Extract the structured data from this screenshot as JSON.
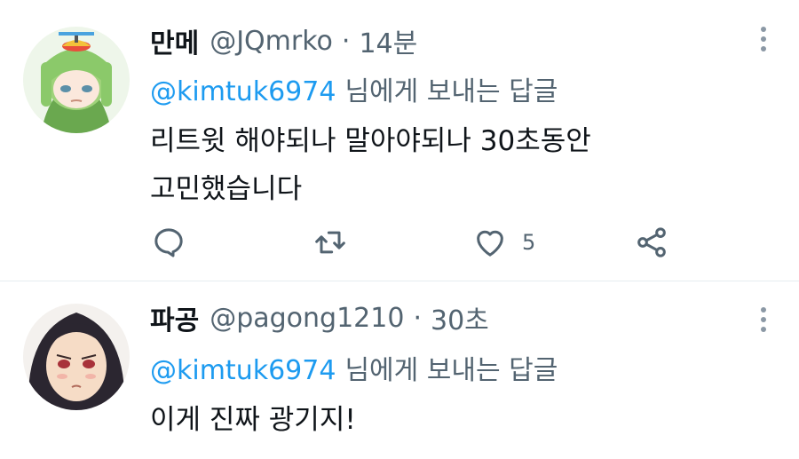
{
  "tweets": [
    {
      "display_name": "만메",
      "handle": "@JQmrko",
      "separator": "·",
      "time": "14분",
      "reply_to": "@kimtuk6974",
      "reply_suffix": "님에게 보내는 답글",
      "body_lines": [
        "리트윗 해야되나 말아야되나 30초동안",
        "고민했습니다"
      ],
      "like_count": "5",
      "icons": [
        "reply-icon",
        "retweet-icon",
        "like-icon",
        "share-icon",
        "more-icon"
      ]
    },
    {
      "display_name": "파공",
      "handle": "@pagong1210",
      "separator": "·",
      "time": "30초",
      "reply_to": "@kimtuk6974",
      "reply_suffix": "님에게 보내는 답글",
      "body_lines": [
        "이게 진짜 광기지!"
      ],
      "icons": [
        "more-icon"
      ]
    }
  ],
  "colors": {
    "accent": "#1d9bf0",
    "secondary_text": "#536471",
    "primary_text": "#0f1419",
    "divider": "#e6ecf0"
  }
}
